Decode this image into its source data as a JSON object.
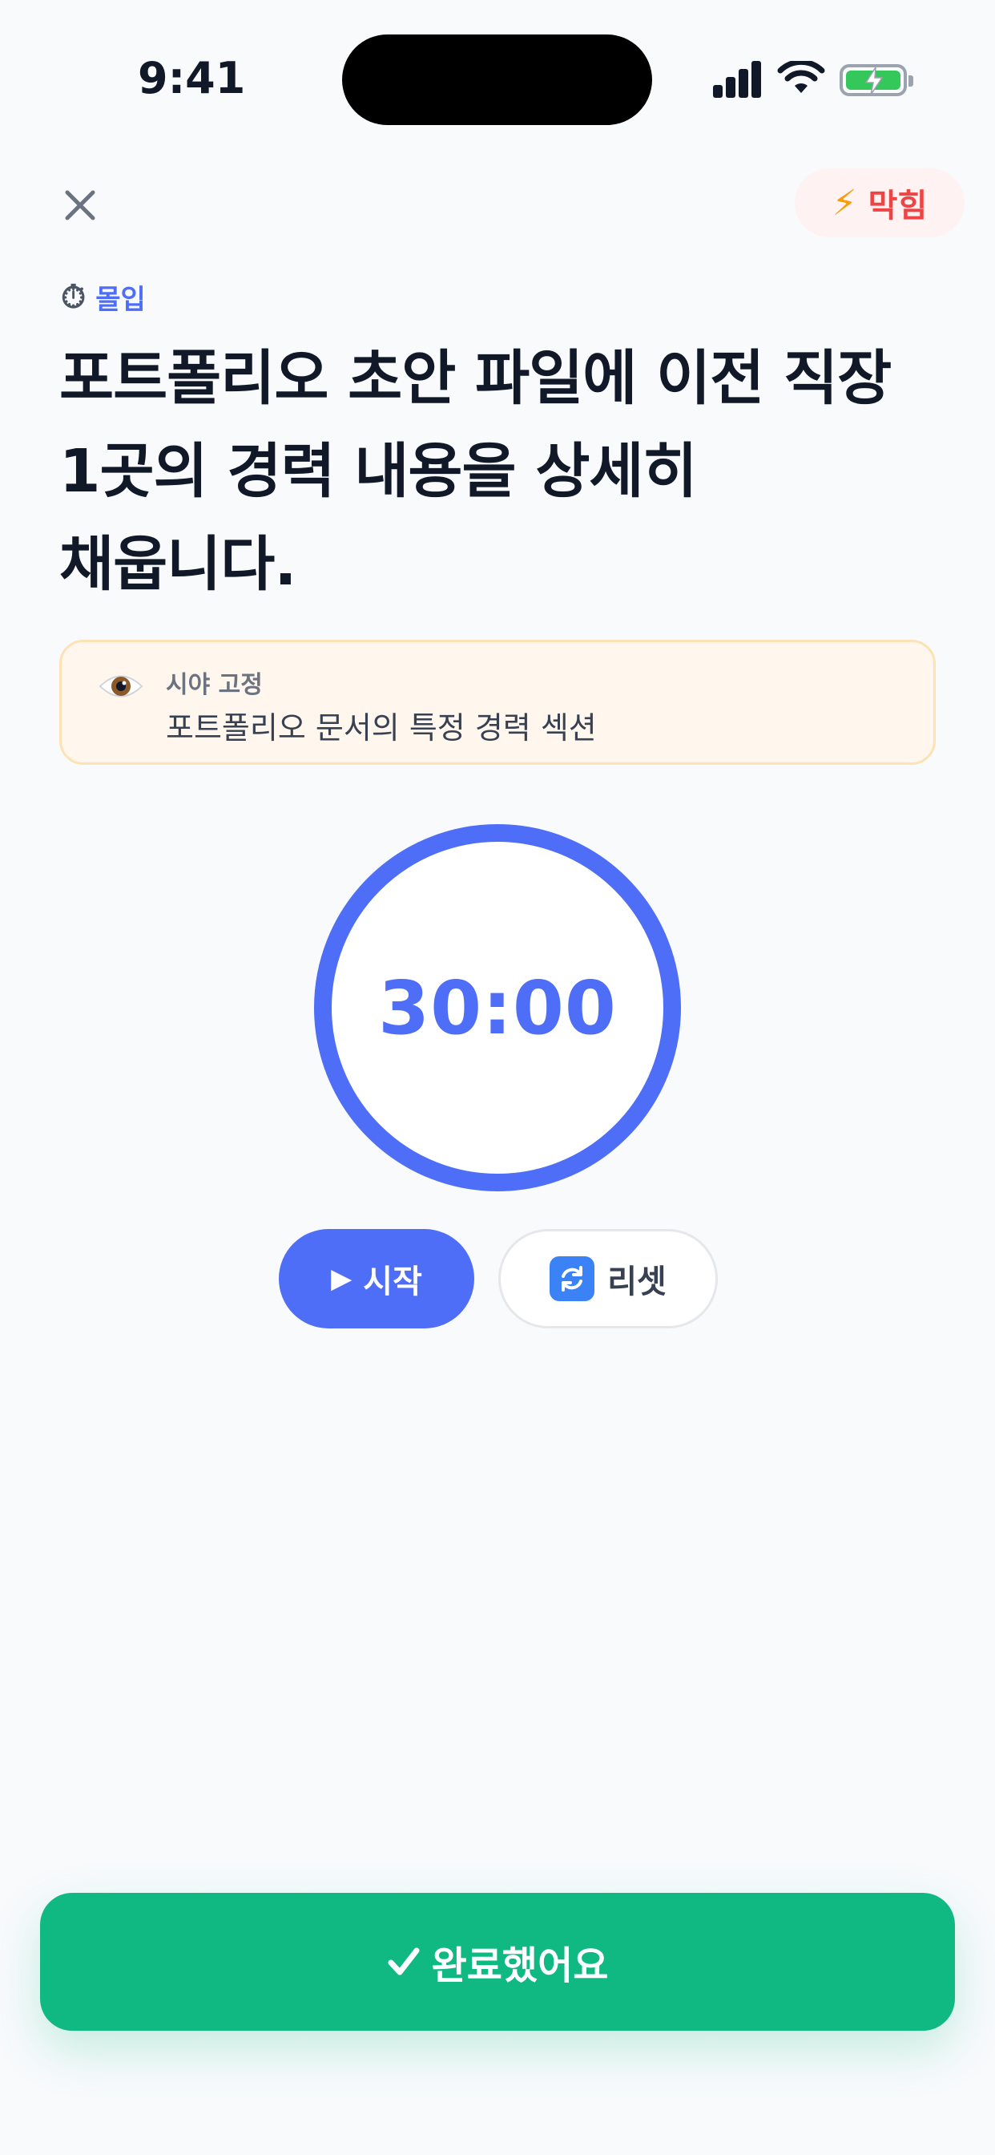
{
  "status_bar": {
    "time": "9:41",
    "icons": [
      "cellular-signal-icon",
      "wifi-icon",
      "battery-charging-icon"
    ]
  },
  "header": {
    "close_icon": "close-icon",
    "stuck_label": "막힘",
    "stuck_icon": "lightning-icon"
  },
  "mode": {
    "label": "몰입",
    "icon": "stopwatch-icon"
  },
  "task": {
    "title_lines": [
      "포트폴리오 초안 파일에 이전 직장",
      "1곳의 경력 내용을 상세히",
      "채웁니다."
    ]
  },
  "focus": {
    "label": "시야 고정",
    "text": "포트폴리오 문서의 특정 경력 섹션",
    "icon": "eye-icon"
  },
  "timer": {
    "display": "30:00"
  },
  "controls": {
    "start_label": "시작",
    "start_icon": "play-icon",
    "reset_label": "리셋",
    "reset_icon": "refresh-icon"
  },
  "complete": {
    "label": "완료했어요",
    "icon": "checkmark-icon"
  },
  "colors": {
    "accent": "#4f6ef7",
    "success": "#10b981",
    "danger": "#ef4444",
    "focus_bg": "#fff7ed"
  }
}
